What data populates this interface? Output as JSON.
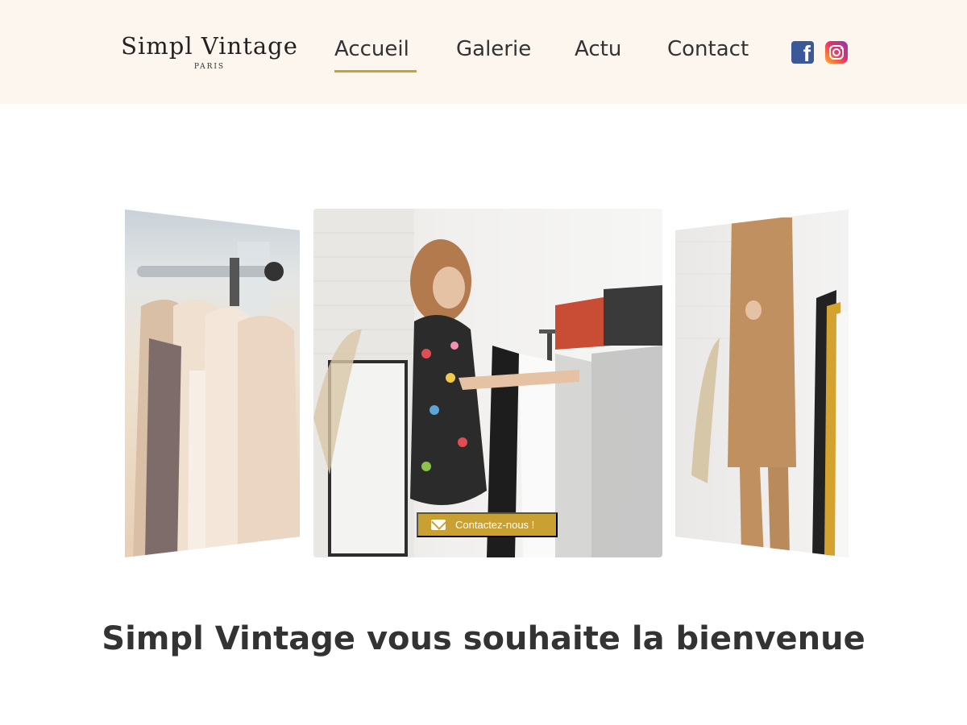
{
  "brand": {
    "name": "Simpl Vintage",
    "tagline": "PARIS",
    "accent_color": "#c9a132",
    "header_bg": "#fdf6ee"
  },
  "nav": {
    "items": [
      {
        "label": "Accueil",
        "active": true
      },
      {
        "label": "Galerie",
        "active": false
      },
      {
        "label": "Actu",
        "active": false
      },
      {
        "label": "Contact",
        "active": false
      }
    ]
  },
  "social": {
    "facebook_icon": "facebook-icon",
    "instagram_icon": "instagram-icon"
  },
  "carousel": {
    "cta_label": "Contactez-nous !",
    "cta_icon": "envelope-icon"
  },
  "main": {
    "headline": "Simpl Vintage vous souhaite la bienvenue"
  }
}
